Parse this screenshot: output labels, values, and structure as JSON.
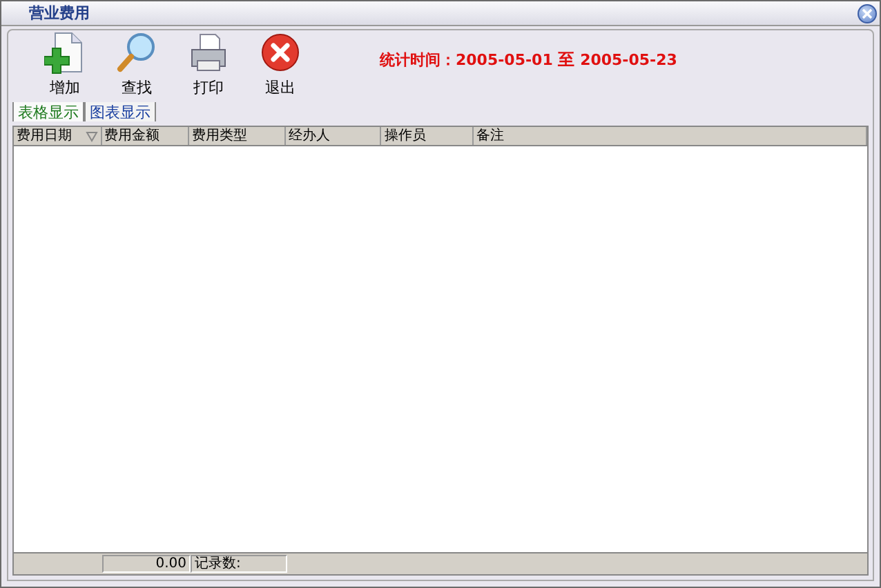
{
  "window": {
    "title": "营业费用"
  },
  "toolbar": [
    {
      "kind": "add",
      "label": "增加"
    },
    {
      "kind": "search",
      "label": "查找"
    },
    {
      "kind": "print",
      "label": "打印"
    },
    {
      "kind": "exit",
      "label": "退出"
    }
  ],
  "period": {
    "label": "统计时间：",
    "start": "2005-05-01",
    "separator": "至",
    "end": "2005-05-23"
  },
  "tabs": [
    {
      "label": "表格显示",
      "selected": true
    },
    {
      "label": "图表显示",
      "selected": false
    }
  ],
  "table": {
    "columns": [
      {
        "label": "费用日期",
        "sorted": true
      },
      {
        "label": "费用金额",
        "sorted": false
      },
      {
        "label": "费用类型",
        "sorted": false
      },
      {
        "label": "经办人",
        "sorted": false
      },
      {
        "label": "操作员",
        "sorted": false
      },
      {
        "label": "备注",
        "sorted": false
      }
    ]
  },
  "footer": {
    "total": "0.00",
    "count_label": "记录数:"
  }
}
